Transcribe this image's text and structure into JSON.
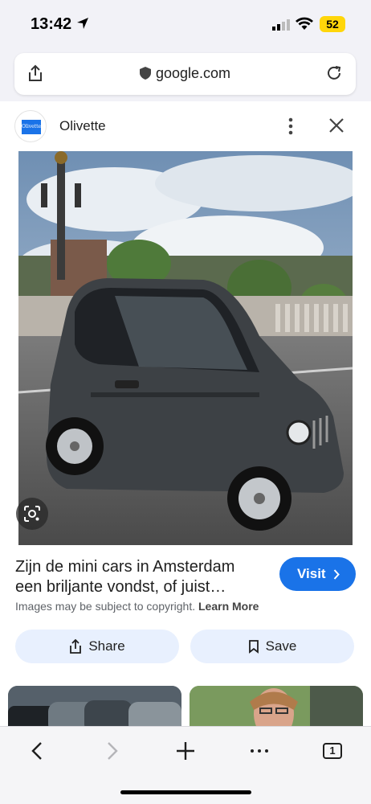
{
  "status_bar": {
    "time": "13:42",
    "battery": "52"
  },
  "url_bar": {
    "domain": "google.com"
  },
  "source": {
    "favicon_text": "Olivette",
    "name": "Olivette"
  },
  "result": {
    "title_line1": "Zijn de mini cars in Amsterdam",
    "title_line2": "een briljante vondst, of juist…",
    "visit_label": "Visit",
    "copyright_text": "Images may be subject to copyright.",
    "learn_more": "Learn More"
  },
  "actions": {
    "share_label": "Share",
    "save_label": "Save"
  },
  "toolbar": {
    "tab_count": "1"
  },
  "colors": {
    "accent": "#1a73e8",
    "button_bg": "#e8f0fe",
    "battery": "#ffd60a"
  }
}
